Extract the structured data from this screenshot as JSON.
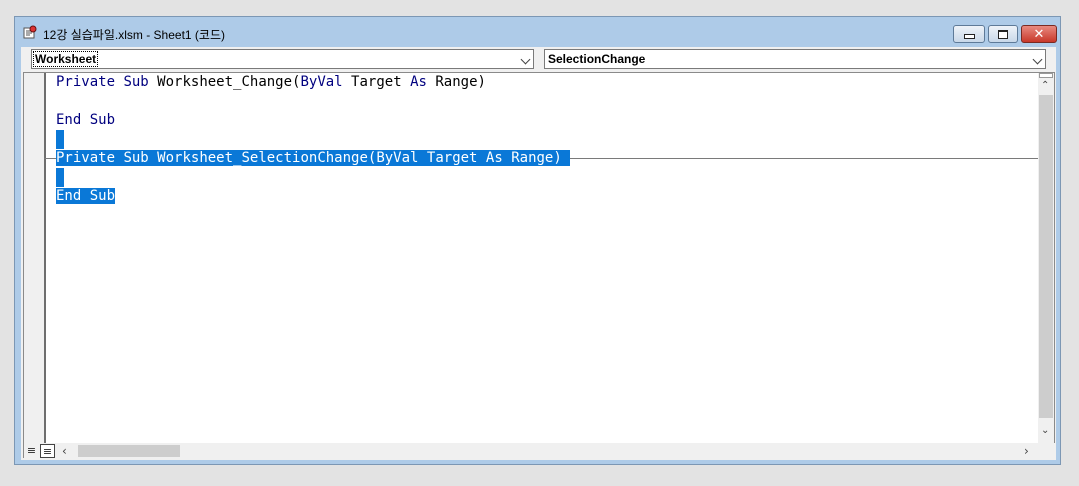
{
  "window": {
    "title": "12강 실습파일.xlsm - Sheet1 (코드)",
    "icon": "vba-code-window-icon",
    "controls": {
      "minimize": "minimize-icon",
      "restore": "restore-icon",
      "close": "✕"
    }
  },
  "object_dropdown": {
    "selected": "Worksheet"
  },
  "procedure_dropdown": {
    "selected": "SelectionChange"
  },
  "code": {
    "lines": [
      {
        "tokens": [
          [
            "kw",
            "Private"
          ],
          [
            "id",
            " "
          ],
          [
            "kw",
            "Sub"
          ],
          [
            "id",
            " Worksheet_Change("
          ],
          [
            "kw",
            "ByVal"
          ],
          [
            "id",
            " Target "
          ],
          [
            "kw",
            "As"
          ],
          [
            "id",
            " Range)"
          ]
        ]
      },
      {
        "tokens": []
      },
      {
        "tokens": [
          [
            "kw",
            "End"
          ],
          [
            "id",
            " "
          ],
          [
            "kw",
            "Sub"
          ]
        ]
      },
      {
        "tokens": []
      },
      {
        "tokens": [
          [
            "kw",
            "Private"
          ],
          [
            "id",
            " "
          ],
          [
            "kw",
            "Sub"
          ],
          [
            "id",
            " Worksheet_SelectionChange("
          ],
          [
            "kw",
            "ByVal"
          ],
          [
            "id",
            " Target "
          ],
          [
            "kw",
            "As"
          ],
          [
            "id",
            " Range) "
          ]
        ]
      },
      {
        "tokens": []
      },
      {
        "tokens": [
          [
            "kw",
            "End"
          ],
          [
            "id",
            " "
          ],
          [
            "kw",
            "Sub"
          ]
        ]
      }
    ]
  },
  "colors": {
    "keyword": "#00007f",
    "selection": "#0a78d7",
    "title_bg": "#aecbe8"
  },
  "statusbar": {
    "procedure_view_icon": "procedure-view-icon",
    "full_module_view_icon": "full-module-view-icon"
  }
}
